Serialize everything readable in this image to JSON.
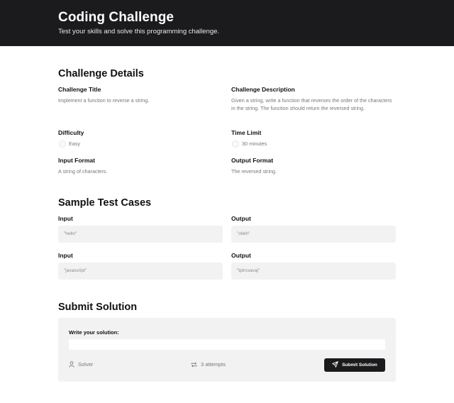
{
  "header": {
    "title": "Coding Challenge",
    "subtitle": "Test your skills and solve this programming challenge."
  },
  "details": {
    "section_title": "Challenge Details",
    "title_label": "Challenge Title",
    "title_value": "Implement a function to reverse a string.",
    "description_label": "Challenge Description",
    "description_value": "Given a string, write a function that reverses the order of the characters in the string. The function should return the reversed string.",
    "difficulty_label": "Difficulty",
    "difficulty_value": "Easy",
    "time_limit_label": "Time Limit",
    "time_limit_value": "30 minutes",
    "input_format_label": "Input Format",
    "input_format_value": "A string of characters.",
    "output_format_label": "Output Format",
    "output_format_value": "The reversed string."
  },
  "test_cases": {
    "section_title": "Sample Test Cases",
    "cases": [
      {
        "input_label": "Input",
        "input": "\"hello\"",
        "output_label": "Output",
        "output": "\"olleh\""
      },
      {
        "input_label": "Input",
        "input": "\"javascript\"",
        "output_label": "Output",
        "output": "\"tpircsavaj\""
      }
    ]
  },
  "submit": {
    "section_title": "Submit Solution",
    "write_label": "Write your solution:",
    "solution_value": "",
    "user": "Solver",
    "attempts": "3 attempts",
    "button_label": "Submit Solution"
  },
  "icons": {
    "difficulty": "difficulty-icon",
    "time": "clock-icon",
    "user": "user-icon",
    "attempts": "repeat-icon",
    "submit": "send-icon"
  },
  "colors": {
    "header_bg": "#1b1b1d",
    "panel_bg": "#f2f2f2",
    "button_bg": "#1b1b1d"
  }
}
